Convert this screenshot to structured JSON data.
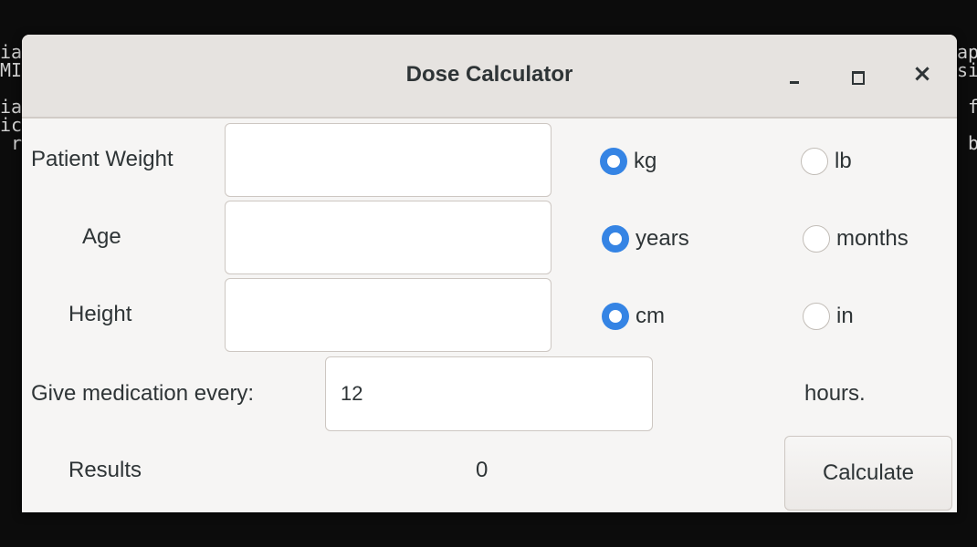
{
  "background_terminal": {
    "left_lines": [
      "ia",
      "MI",
      "",
      "ia",
      "ic",
      " r"
    ],
    "right_lines": [
      "ap",
      "si",
      "",
      " f",
      "",
      " b"
    ]
  },
  "window": {
    "title": "Dose Calculator",
    "controls": {
      "minimize": "_",
      "maximize": "□",
      "close": "×"
    }
  },
  "form": {
    "weight": {
      "label": "Patient Weight",
      "value": "",
      "units": [
        {
          "label": "kg",
          "checked": true
        },
        {
          "label": "lb",
          "checked": false
        }
      ]
    },
    "age": {
      "label": "Age",
      "value": "",
      "units": [
        {
          "label": "years",
          "checked": true
        },
        {
          "label": "months",
          "checked": false
        }
      ]
    },
    "height": {
      "label": "Height",
      "value": "",
      "units": [
        {
          "label": "cm",
          "checked": true
        },
        {
          "label": "in",
          "checked": false
        }
      ]
    },
    "frequency": {
      "label": "Give medication every:",
      "value": "12",
      "unit_label": "hours."
    },
    "results": {
      "label": "Results",
      "value": "0"
    },
    "calculate_label": "Calculate"
  },
  "colors": {
    "accent": "#3584e4",
    "window_bg": "#f6f5f4",
    "titlebar_bg": "#e6e3e0",
    "terminal_bg": "#0c0c0c"
  }
}
